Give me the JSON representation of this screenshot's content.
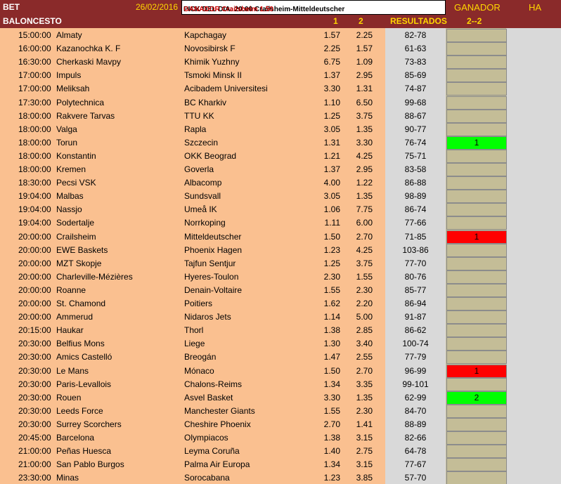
{
  "header": {
    "bet": "BET",
    "date": "26/02/2016",
    "pick_label": "PICK DEL DIA: 20:00 Crailsheim-Mitteldeutscher",
    "pick_result": "GANADOR Crailsheim 1.50",
    "ganador": "GANADOR",
    "ha": "HA"
  },
  "subheader": {
    "sport": "BALONCESTO",
    "col1": "1",
    "col2": "2",
    "resultados": "RESULTADOS",
    "ganador_col": "2--2"
  },
  "colors": {
    "header_bg": "#8a2a2a",
    "odds_band": "#fac090",
    "result_band": "#d9d9d9",
    "pick_cell": "#c4bd97",
    "win": "#00ff00",
    "loss": "#ff0000"
  },
  "rows": [
    {
      "time": "15:00:00",
      "home": "Almaty",
      "away": "Kapchagay",
      "o1": "1.57",
      "o2": "2.25",
      "result": "82-78",
      "pick": "",
      "status": ""
    },
    {
      "time": "16:00:00",
      "home": "Kazanochka K. F",
      "away": "Novosibirsk F",
      "o1": "2.25",
      "o2": "1.57",
      "result": "61-63",
      "pick": "",
      "status": ""
    },
    {
      "time": "16:30:00",
      "home": "Cherkaski Mavpy",
      "away": "Khimik Yuzhny",
      "o1": "6.75",
      "o2": "1.09",
      "result": "73-83",
      "pick": "",
      "status": ""
    },
    {
      "time": "17:00:00",
      "home": "Impuls",
      "away": "Tsmoki Minsk II",
      "o1": "1.37",
      "o2": "2.95",
      "result": "85-69",
      "pick": "",
      "status": ""
    },
    {
      "time": "17:00:00",
      "home": "Meliksah",
      "away": "Acibadem Universitesi",
      "o1": "3.30",
      "o2": "1.31",
      "result": "74-87",
      "pick": "",
      "status": ""
    },
    {
      "time": "17:30:00",
      "home": "Polytechnica",
      "away": "BC Kharkiv",
      "o1": "1.10",
      "o2": "6.50",
      "result": "99-68",
      "pick": "",
      "status": ""
    },
    {
      "time": "18:00:00",
      "home": "Rakvere Tarvas",
      "away": "TTU KK",
      "o1": "1.25",
      "o2": "3.75",
      "result": "88-67",
      "pick": "",
      "status": ""
    },
    {
      "time": "18:00:00",
      "home": "Valga",
      "away": "Rapla",
      "o1": "3.05",
      "o2": "1.35",
      "result": "90-77",
      "pick": "",
      "status": ""
    },
    {
      "time": "18:00:00",
      "home": "Torun",
      "away": "Szczecin",
      "o1": "1.31",
      "o2": "3.30",
      "result": "76-74",
      "pick": "1",
      "status": "green"
    },
    {
      "time": "18:00:00",
      "home": "Konstantin",
      "away": "OKK Beograd",
      "o1": "1.21",
      "o2": "4.25",
      "result": "75-71",
      "pick": "",
      "status": ""
    },
    {
      "time": "18:00:00",
      "home": "Kremen",
      "away": "Goverla",
      "o1": "1.37",
      "o2": "2.95",
      "result": "83-58",
      "pick": "",
      "status": ""
    },
    {
      "time": "18:30:00",
      "home": "Pecsi VSK",
      "away": "Albacomp",
      "o1": "4.00",
      "o2": "1.22",
      "result": "86-88",
      "pick": "",
      "status": ""
    },
    {
      "time": "19:04:00",
      "home": "Malbas",
      "away": "Sundsvall",
      "o1": "3.05",
      "o2": "1.35",
      "result": "98-89",
      "pick": "",
      "status": ""
    },
    {
      "time": "19:04:00",
      "home": "Nassjo",
      "away": "Umeå IK",
      "o1": "1.06",
      "o2": "7.75",
      "result": "86-74",
      "pick": "",
      "status": ""
    },
    {
      "time": "19:04:00",
      "home": "Sodertalje",
      "away": "Norrkoping",
      "o1": "1.11",
      "o2": "6.00",
      "result": "77-66",
      "pick": "",
      "status": ""
    },
    {
      "time": "20:00:00",
      "home": "Crailsheim",
      "away": "Mitteldeutscher",
      "o1": "1.50",
      "o2": "2.70",
      "result": "71-85",
      "pick": "1",
      "status": "red"
    },
    {
      "time": "20:00:00",
      "home": "EWE Baskets",
      "away": "Phoenix Hagen",
      "o1": "1.23",
      "o2": "4.25",
      "result": "103-86",
      "pick": "",
      "status": ""
    },
    {
      "time": "20:00:00",
      "home": "MZT Skopje",
      "away": "Tajfun Sentjur",
      "o1": "1.25",
      "o2": "3.75",
      "result": "77-70",
      "pick": "",
      "status": ""
    },
    {
      "time": "20:00:00",
      "home": "Charleville-Mézières",
      "away": "Hyeres-Toulon",
      "o1": "2.30",
      "o2": "1.55",
      "result": "80-76",
      "pick": "",
      "status": ""
    },
    {
      "time": "20:00:00",
      "home": "Roanne",
      "away": "Denain-Voltaire",
      "o1": "1.55",
      "o2": "2.30",
      "result": "85-77",
      "pick": "",
      "status": ""
    },
    {
      "time": "20:00:00",
      "home": "St. Chamond",
      "away": "Poitiers",
      "o1": "1.62",
      "o2": "2.20",
      "result": "86-94",
      "pick": "",
      "status": ""
    },
    {
      "time": "20:00:00",
      "home": "Ammerud",
      "away": "Nidaros Jets",
      "o1": "1.14",
      "o2": "5.00",
      "result": "91-87",
      "pick": "",
      "status": ""
    },
    {
      "time": "20:15:00",
      "home": "Haukar",
      "away": "Thorl",
      "o1": "1.38",
      "o2": "2.85",
      "result": "86-62",
      "pick": "",
      "status": ""
    },
    {
      "time": "20:30:00",
      "home": "Belfius Mons",
      "away": "Liege",
      "o1": "1.30",
      "o2": "3.40",
      "result": "100-74",
      "pick": "",
      "status": ""
    },
    {
      "time": "20:30:00",
      "home": "Amics Castelló",
      "away": "Breogán",
      "o1": "1.47",
      "o2": "2.55",
      "result": "77-79",
      "pick": "",
      "status": ""
    },
    {
      "time": "20:30:00",
      "home": "Le Mans",
      "away": "Mónaco",
      "o1": "1.50",
      "o2": "2.70",
      "result": "96-99",
      "pick": "1",
      "status": "red"
    },
    {
      "time": "20:30:00",
      "home": "Paris-Levallois",
      "away": "Chalons-Reims",
      "o1": "1.34",
      "o2": "3.35",
      "result": "99-101",
      "pick": "",
      "status": ""
    },
    {
      "time": "20:30:00",
      "home": "Rouen",
      "away": "Asvel Basket",
      "o1": "3.30",
      "o2": "1.35",
      "result": "62-99",
      "pick": "2",
      "status": "green"
    },
    {
      "time": "20:30:00",
      "home": "Leeds Force",
      "away": "Manchester Giants",
      "o1": "1.55",
      "o2": "2.30",
      "result": "84-70",
      "pick": "",
      "status": ""
    },
    {
      "time": "20:30:00",
      "home": "Surrey Scorchers",
      "away": "Cheshire Phoenix",
      "o1": "2.70",
      "o2": "1.41",
      "result": "88-89",
      "pick": "",
      "status": ""
    },
    {
      "time": "20:45:00",
      "home": "Barcelona",
      "away": "Olympiacos",
      "o1": "1.38",
      "o2": "3.15",
      "result": "82-66",
      "pick": "",
      "status": ""
    },
    {
      "time": "21:00:00",
      "home": "Peñas Huesca",
      "away": "Leyma Coruña",
      "o1": "1.40",
      "o2": "2.75",
      "result": "64-78",
      "pick": "",
      "status": ""
    },
    {
      "time": "21:00:00",
      "home": "San Pablo Burgos",
      "away": "Palma Air Europa",
      "o1": "1.34",
      "o2": "3.15",
      "result": "77-67",
      "pick": "",
      "status": ""
    },
    {
      "time": "23:30:00",
      "home": "Minas",
      "away": "Sorocabana",
      "o1": "1.23",
      "o2": "3.85",
      "result": "57-70",
      "pick": "",
      "status": ""
    }
  ]
}
